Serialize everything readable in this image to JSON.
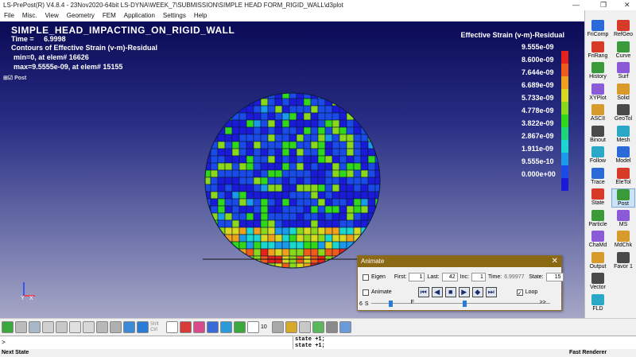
{
  "window": {
    "title": "LS-PrePost(R) V4.8.4 - 23Nov2020-64bit LS-DYNA\\WEEK_7\\SUBMISSION\\SIMPLE HEAD FORM_RIGID_WALL\\d3plot"
  },
  "menu": [
    "File",
    "Misc.",
    "View",
    "Geometry",
    "FEM",
    "Application",
    "Settings",
    "Help"
  ],
  "viewport": {
    "title": "SIMPLE_HEAD_IMPACTING_ON_RIGID_WALL",
    "time_label": "Time =",
    "time_value": "6.9998",
    "contours": "Contours of Effective Strain (v-m)-Residual",
    "min": "min=0, at elem# 16626",
    "max": "max=9.5555e-09, at elem# 15155",
    "tree_item": "Post"
  },
  "colorbar": {
    "title": "Effective Strain (v-m)-Residual",
    "labels": [
      "9.555e-09",
      "8.600e-09",
      "7.644e-09",
      "6.689e-09",
      "5.733e-09",
      "4.778e-09",
      "3.822e-09",
      "2.867e-09",
      "1.911e-09",
      "9.555e-10",
      "0.000e+00"
    ],
    "colors": [
      "#e8201a",
      "#f05a1a",
      "#f0a01a",
      "#d8d820",
      "#8ad81a",
      "#30d81a",
      "#1ad87a",
      "#1ad8d0",
      "#1a9ae8",
      "#1a4ae8",
      "#1a1ad8"
    ]
  },
  "right_panel": [
    [
      "FriComp",
      "RefGeo"
    ],
    [
      "FriRang",
      "Curve"
    ],
    [
      "History",
      "Surf"
    ],
    [
      "XYPlot",
      "Solid"
    ],
    [
      "ASCII",
      "GeoTol"
    ],
    [
      "Binout",
      "Mesh"
    ],
    [
      "Follow",
      "Model"
    ],
    [
      "Trace",
      "EleTol"
    ],
    [
      "State",
      "Post"
    ],
    [
      "Particle",
      "MS"
    ],
    [
      "ChaMd",
      "MdChk"
    ],
    [
      "Output",
      "Favor 1"
    ],
    [
      "Vector",
      ""
    ],
    [
      "FLD",
      ""
    ]
  ],
  "animate": {
    "title": "Animate",
    "eigen": "Eigen",
    "first_label": "First:",
    "first": "1",
    "last_label": "Last:",
    "last": "42",
    "inc_label": "Inc:",
    "inc": "1",
    "time_label": "Time:",
    "time": "6.99977",
    "state_label": "State:",
    "state": "15",
    "animate_label": "Animate",
    "loop_label": "Loop",
    "s_label": "S",
    "f_label": "F",
    "six": "6",
    "arrows": ">>"
  },
  "toolbar": {
    "shift": "Shft",
    "ctrl": "Ctrl",
    "ten": "10"
  },
  "command": {
    "prompt": ">",
    "log": [
      "state +1;",
      "state +1;"
    ]
  },
  "status": {
    "left": "Next State",
    "right": "Fast Renderer"
  }
}
